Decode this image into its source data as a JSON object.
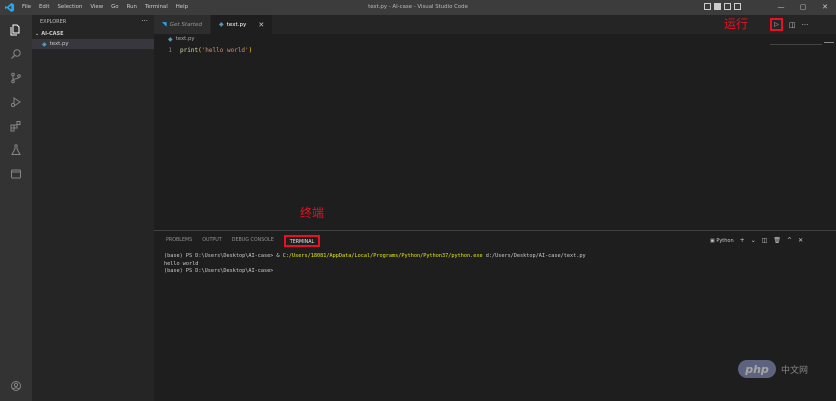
{
  "window": {
    "title": "text.py - AI-case - Visual Studio Code",
    "menu": [
      "File",
      "Edit",
      "Selection",
      "View",
      "Go",
      "Run",
      "Terminal",
      "Help"
    ],
    "controls": [
      "—",
      "▢",
      "✕"
    ]
  },
  "sidebar": {
    "header": "EXPLORER",
    "more": "···",
    "folder": "AI-CASE",
    "file": "text.py"
  },
  "tabs": [
    {
      "label": "Get Started",
      "active": false
    },
    {
      "label": "text.py",
      "active": true,
      "close": "✕"
    }
  ],
  "editor": {
    "breadcrumb": "text.py",
    "line_number": "1",
    "code": {
      "fn": "print",
      "open": "(",
      "str": "'hello world'",
      "close": ")"
    },
    "run_icon": "▷",
    "split_icon": "◫",
    "more_icon": "···"
  },
  "annotations": {
    "run": "运行",
    "terminal": "终端"
  },
  "panel": {
    "tabs": [
      "PROBLEMS",
      "OUTPUT",
      "DEBUG CONSOLE",
      "TERMINAL"
    ],
    "active_tab": "TERMINAL",
    "shell": "Python",
    "actions": [
      "+",
      "⌄",
      "◫",
      "🗑",
      "^",
      "✕"
    ],
    "terminal_lines": [
      {
        "prefix": "(base) PS D:\\Users\\Desktop\\AI-case> & ",
        "highlight": "C:/Users/18081/AppData/Local/Programs/Python/Python37/python.exe",
        "suffix": " d:/Users/Desktop/AI-case/text.py"
      },
      {
        "prefix": "hello world",
        "highlight": "",
        "suffix": ""
      },
      {
        "prefix": "(base) PS D:\\Users\\Desktop\\AI-case>",
        "highlight": "",
        "suffix": ""
      }
    ]
  },
  "watermark": {
    "logo": "php",
    "text": "中文网"
  },
  "colors": {
    "accent": "#23a9f2",
    "annotation_red": "#e81123",
    "python_icon": "#519aba"
  },
  "activity_icons": [
    "files-icon",
    "search-icon",
    "source-control-icon",
    "run-debug-icon",
    "extensions-icon",
    "testing-icon",
    "remote-explorer-icon",
    "account-icon"
  ]
}
